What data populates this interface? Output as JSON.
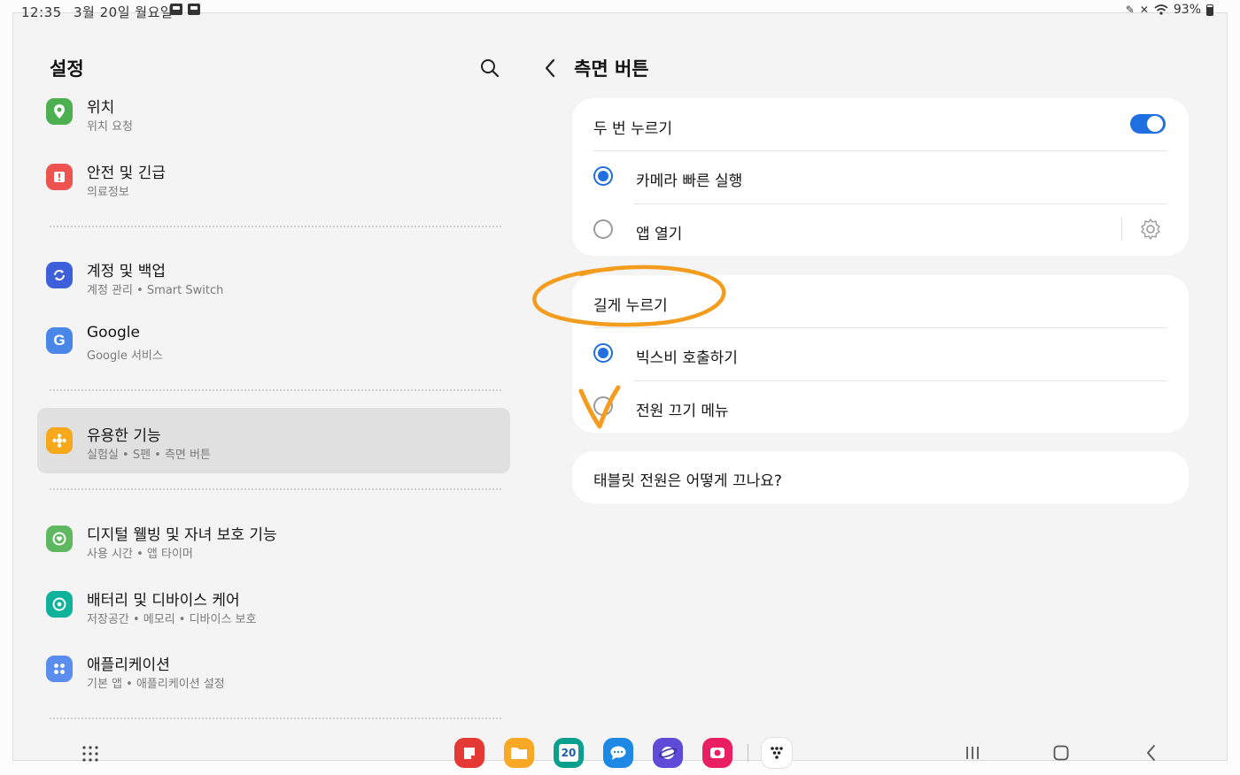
{
  "status": {
    "time": "12:35",
    "date": "3월 20일 월요일",
    "battery": "93%"
  },
  "left": {
    "title": "설정",
    "items": [
      {
        "title": "위치",
        "subtitle": "위치 요청",
        "color": "#4caf50",
        "icon": "location-pin-icon"
      },
      {
        "title": "안전 및 긴급",
        "subtitle": "의료정보",
        "color": "#ef5350",
        "icon": "emergency-icon"
      },
      {
        "title": "계정 및 백업",
        "subtitle": "계정 관리 • Smart Switch",
        "color": "#3d5fd9",
        "icon": "sync-icon"
      },
      {
        "title": "Google",
        "subtitle": "Google 서비스",
        "color": "#4a86e8",
        "icon": "google-icon"
      },
      {
        "title": "유용한 기능",
        "subtitle": "실험실 • S펜 • 측면 버튼",
        "color": "#f7a81b",
        "icon": "puzzle-icon",
        "selected": true
      },
      {
        "title": "디지털 웰빙 및 자녀 보호 기능",
        "subtitle": "사용 시간 • 앱 타이머",
        "color": "#5fb85f",
        "icon": "wellbeing-icon"
      },
      {
        "title": "배터리 및 디바이스 케어",
        "subtitle": "저장공간 • 메모리 • 디바이스 보호",
        "color": "#0fb39b",
        "icon": "device-care-icon"
      },
      {
        "title": "애플리케이션",
        "subtitle": "기본 앱 • 애플리케이션 설정",
        "color": "#5b8def",
        "icon": "apps-icon"
      }
    ]
  },
  "right": {
    "title": "측면 버튼",
    "double_press": {
      "label": "두 번 누르기",
      "enabled": true,
      "options": [
        {
          "label": "카메라 빠른 실행",
          "checked": true
        },
        {
          "label": "앱 열기",
          "checked": false
        }
      ]
    },
    "long_press": {
      "label": "길게 누르기",
      "options": [
        {
          "label": "빅스비 호출하기",
          "checked": true
        },
        {
          "label": "전원 끄기 메뉴",
          "checked": false
        }
      ]
    },
    "help_link": "태블릿 전원은 어떻게 끄나요?"
  },
  "annotation_color": "#f39c1e",
  "nav": {
    "calendar_day": "20",
    "apps": [
      "notes-app-icon",
      "files-app-icon",
      "calendar-app-icon",
      "messages-app-icon",
      "internet-app-icon",
      "screen-recorder-app-icon",
      "apps-edge-icon"
    ]
  }
}
